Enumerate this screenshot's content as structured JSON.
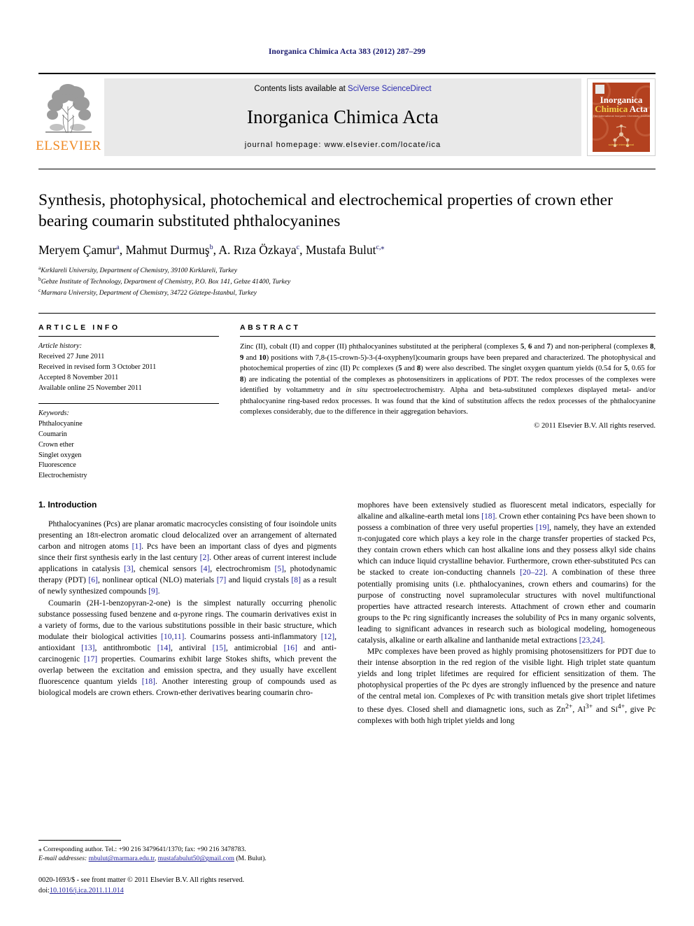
{
  "running_head": "Inorganica Chimica Acta 383 (2012) 287–299",
  "masthead": {
    "publisher_name": "ELSEVIER",
    "contents_prefix": "Contents lists available at",
    "contents_link": "SciVerse ScienceDirect",
    "journal_title": "Inorganica Chimica Acta",
    "homepage_label": "journal homepage: www.elsevier.com/locate/ica",
    "cover": {
      "line1": "Inorganica",
      "line2_left": "Chimica",
      "line2_right": "Acta",
      "subtitle": "The International Inorganic Chemistry Journal",
      "footer": "science international"
    }
  },
  "article": {
    "title": "Synthesis, photophysical, photochemical and electrochemical properties of crown ether bearing coumarin substituted phthalocyanines",
    "authors": [
      {
        "name": "Meryem Çamur",
        "marks": "a"
      },
      {
        "name": "Mahmut Durmuş",
        "marks": "b"
      },
      {
        "name": "A. Rıza Özkaya",
        "marks": "c"
      },
      {
        "name": "Mustafa Bulut",
        "marks": "c,*"
      }
    ],
    "affiliations": [
      {
        "mark": "a",
        "text": "Kırklareli University, Department of Chemistry, 39100 Kırklareli, Turkey"
      },
      {
        "mark": "b",
        "text": "Gebze Institute of Technology, Department of Chemistry, P.O. Box 141, Gebze 41400, Turkey"
      },
      {
        "mark": "c",
        "text": "Marmara University, Department of Chemistry, 34722 Göztepe-İstanbul, Turkey"
      }
    ]
  },
  "article_info": {
    "heading": "ARTICLE INFO",
    "history_label": "Article history:",
    "history": [
      "Received 27 June 2011",
      "Received in revised form 3 October 2011",
      "Accepted 8 November 2011",
      "Available online 25 November 2011"
    ],
    "keywords_label": "Keywords:",
    "keywords": [
      "Phthalocyanine",
      "Coumarin",
      "Crown ether",
      "Singlet oxygen",
      "Fluorescence",
      "Electrochemistry"
    ]
  },
  "abstract": {
    "heading": "ABSTRACT",
    "paragraph_html": "Zinc (II), cobalt (II) and copper (II) phthalocyanines substituted at the peripheral (complexes <b>5</b>, <b>6</b> and <b>7</b>) and non-peripheral (complexes <b>8</b>, <b>9</b> and <b>10</b>) positions with 7,8-(15-crown-5)-3-(4-oxyphenyl)coumarin groups have been prepared and characterized. The photophysical and photochemical properties of zinc (II) Pc complexes (<b>5</b> and <b>8</b>) were also described. The singlet oxygen quantum yields (0.54 for <b>5</b>, 0.65 for <b>8</b>) are indicating the potential of the complexes as photosensitizers in applications of PDT. The redox processes of the complexes were identified by voltammetry and <i>in situ</i> spectroelectrochemistry. Alpha and beta-substituted complexes displayed metal- and/or phthalocyanine ring-based redox processes. It was found that the kind of substitution affects the redox processes of the phthalocyanine complexes considerably, due to the difference in their aggregation behaviors.",
    "copyright": "© 2011 Elsevier B.V. All rights reserved."
  },
  "body": {
    "section_number_title": "1. Introduction",
    "left_paragraphs_html": [
      "Phthalocyanines (Pcs) are planar aromatic macrocycles consisting of four isoindole units presenting an 18π-electron aromatic cloud delocalized over an arrangement of alternated carbon and nitrogen atoms <span class=\"ref\">[1]</span>. Pcs have been an important class of dyes and pigments since their first synthesis early in the last century <span class=\"ref\">[2]</span>. Other areas of current interest include applications in catalysis <span class=\"ref\">[3]</span>, chemical sensors <span class=\"ref\">[4]</span>, electrochromism <span class=\"ref\">[5]</span>, photodynamic therapy (PDT) <span class=\"ref\">[6]</span>, nonlinear optical (NLO) materials <span class=\"ref\">[7]</span> and liquid crystals <span class=\"ref\">[8]</span> as a result of newly synthesized compounds <span class=\"ref\">[9]</span>.",
      "Coumarin (2H-1-benzopyran-2-one) is the simplest naturally occurring phenolic substance possessing fused benzene and α-pyrone rings. The coumarin derivatives exist in a variety of forms, due to the various substitutions possible in their basic structure, which modulate their biological activities <span class=\"ref\">[10,11]</span>. Coumarins possess anti-inflammatory <span class=\"ref\">[12]</span>, antioxidant <span class=\"ref\">[13]</span>, antithrombotic <span class=\"ref\">[14]</span>, antiviral <span class=\"ref\">[15]</span>, antimicrobial <span class=\"ref\">[16]</span> and anti-carcinogenic <span class=\"ref\">[17]</span> properties. Coumarins exhibit large Stokes shifts, which prevent the overlap between the excitation and emission spectra, and they usually have excellent fluorescence quantum yields <span class=\"ref\">[18]</span>. Another interesting group of compounds used as biological models are crown ethers. Crown-ether derivatives bearing coumarin chro-"
    ],
    "right_paragraphs_html": [
      "mophores have been extensively studied as fluorescent metal indicators, especially for alkaline and alkaline-earth metal ions <span class=\"ref\">[18]</span>. Crown ether containing Pcs have been shown to possess a combination of three very useful properties <span class=\"ref\">[19]</span>, namely, they have an extended π-conjugated core which plays a key role in the charge transfer properties of stacked Pcs, they contain crown ethers which can host alkaline ions and they possess alkyl side chains which can induce liquid crystalline behavior. Furthermore, crown ether-substituted Pcs can be stacked to create ion-conducting channels <span class=\"ref\">[20–22]</span>. A combination of these three potentially promising units (i.e. phthalocyanines, crown ethers and coumarins) for the purpose of constructing novel supramolecular structures with novel multifunctional properties have attracted research interests. Attachment of crown ether and coumarin groups to the Pc ring significantly increases the solubility of Pcs in many organic solvents, leading to significant advances in research such as biological modeling, homogeneous catalysis, alkaline or earth alkaline and lanthanide metal extractions <span class=\"ref\">[23,24]</span>.",
      "MPc complexes have been proved as highly promising photosensitizers for PDT due to their intense absorption in the red region of the visible light. High triplet state quantum yields and long triplet lifetimes are required for efficient sensitization of them. The photophysical properties of the Pc dyes are strongly influenced by the presence and nature of the central metal ion. Complexes of Pc with transition metals give short triplet lifetimes to these dyes. Closed shell and diamagnetic ions, such as Zn<sup>2+</sup>, Al<sup>3+</sup> and Si<sup>4+</sup>, give Pc complexes with both high triplet yields and long"
    ]
  },
  "footnotes": {
    "corresponding_html": "<span class=\"star\">⁎</span> Corresponding author. Tel.: +90 216 3479641/1370; fax: +90 216 3478783.",
    "email_label": "E-mail addresses:",
    "emails": [
      "mbulut@marmara.edu.tr",
      "mustafabulut50@gmail.com"
    ],
    "email_person": "(M. Bulut).",
    "imprint_line1": "0020-1693/$ - see front matter © 2011 Elsevier B.V. All rights reserved.",
    "doi_label": "doi:",
    "doi_value": "10.1016/j.ica.2011.11.014"
  },
  "colors": {
    "link": "#23239b",
    "running_head": "#1a1a6e",
    "elsevier_orange": "#f08a24",
    "cover_red": "#b3411f",
    "masthead_gray": "#e9e9e9"
  }
}
